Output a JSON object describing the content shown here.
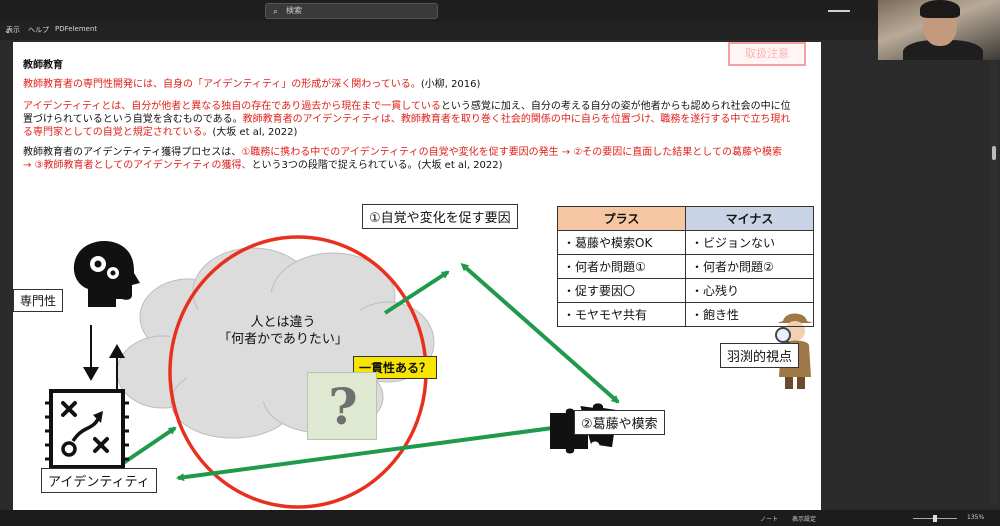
{
  "window": {
    "search_placeholder": "検索",
    "menu": [
      "表示",
      "ヘルプ",
      "PDFelement"
    ]
  },
  "slide": {
    "stamp": "取扱注意",
    "heading": "教師教育",
    "p1": {
      "red": "教師教育者の専門性開発には、自身の「アイデンティティ」の形成が深く関わっている。",
      "cite": "(小柳, 2016)"
    },
    "p2": {
      "red1": "アイデンティティとは、自分が他者と異なる独自の存在であり過去から現在まで一貫している",
      "black1": "という感覚に加え、自分の考える自分の姿が他者からも認められ社会の中に位置づけられているという自覚を含むものである。",
      "red2": "教師教育者のアイデンティティは、教師教育者を取り巻く社会的関係の中に自らを位置づけ、職務を遂行する中で立ち現れる専門家としての自覚と規定されている。",
      "cite": "(大坂 et al, 2022)"
    },
    "p3": {
      "black1": "教師教育者のアイデンティティ獲得プロセスは、",
      "red1": "①職務に携わる中でのアイデンティティの自覚や変化を促す要因の発生 → ②その要因に直面した結果としての葛藤や模索 → ③教師教育者としてのアイデンティティの獲得、",
      "black2": "という3つの段階で捉えられている。",
      "cite": "(大坂 et al, 2022)"
    }
  },
  "diagram": {
    "expert_label": "専門性",
    "cause_label": "①自覚や変化を促す要因",
    "struggle_label": "②葛藤や模索",
    "identity_label": "アイデンティティ",
    "cloud_line1": "人とは違う",
    "cloud_line2": "「何者かでありたい」",
    "consistency_label": "一貫性ある？",
    "question_mark": "?",
    "viewpoint_label": "羽渕的視点",
    "colors": {
      "arrow": "#1e9a4a",
      "circle": "#e8301f",
      "cloud": "#dcdcdc"
    },
    "icons": [
      "head-gears-icon",
      "strategy-board-icon",
      "puzzle-pieces-icon",
      "detective-icon",
      "up-arrow-icon",
      "down-arrow-icon"
    ]
  },
  "table": {
    "headers": [
      "プラス",
      "マイナス"
    ],
    "rows": [
      [
        "・葛藤や模索OK",
        "・ビジョンない"
      ],
      [
        "・何者か問題①",
        "・何者か問題②"
      ],
      [
        "・促す要因〇",
        "・心残り"
      ],
      [
        "・モヤモヤ共有",
        "・飽き性"
      ]
    ]
  },
  "status": {
    "note": "ノート",
    "view": "表示設定",
    "zoom": "135%"
  }
}
